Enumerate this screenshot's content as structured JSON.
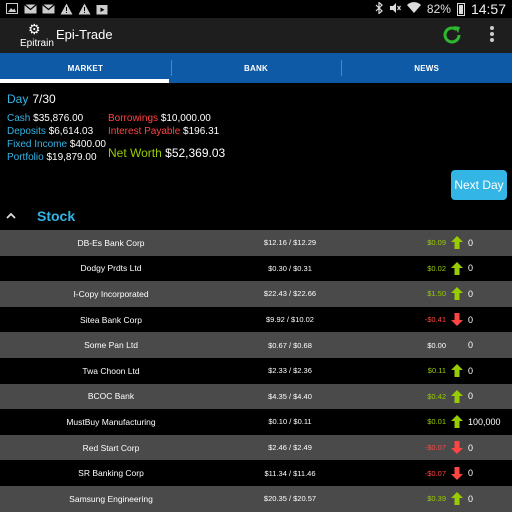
{
  "status_bar": {
    "notification_icons": [
      "image-icon",
      "mail-icon",
      "mail-icon",
      "warning-icon",
      "warning-icon",
      "play-store-icon"
    ],
    "battery": "82%",
    "time": "14:57"
  },
  "action_bar": {
    "logo_text": "Epitrain",
    "title": "Epi-Trade",
    "refresh_color": "#2eb82e"
  },
  "tabs": [
    {
      "label": "MARKET",
      "active": true
    },
    {
      "label": "BANK",
      "active": false
    },
    {
      "label": "NEWS",
      "active": false
    }
  ],
  "summary": {
    "day_label": "Day",
    "day_value": "7/30",
    "cash_label": "Cash",
    "cash_value": "$35,876.00",
    "deposits_label": "Deposits",
    "deposits_value": "$6,614.03",
    "fixed_income_label": "Fixed Income",
    "fixed_income_value": "$400.00",
    "portfolio_label": "Portfolio",
    "portfolio_value": "$19,879.00",
    "borrowings_label": "Borrowings",
    "borrowings_value": "$10,000.00",
    "interest_label": "Interest Payable",
    "interest_value": "$196.31",
    "net_worth_label": "Net Worth",
    "net_worth_value": "$52,369.03",
    "next_day_label": "Next Day"
  },
  "section": {
    "title": "Stock"
  },
  "stocks": [
    {
      "name": "DB-Es Bank Corp",
      "price": "$12.16 / $12.29",
      "change": "$0.09",
      "dir": "up",
      "qty": "0"
    },
    {
      "name": "Dodgy Prdts Ltd",
      "price": "$0.30 / $0.31",
      "change": "$0.02",
      "dir": "up",
      "qty": "0"
    },
    {
      "name": "I-Copy Incorporated",
      "price": "$22.43 / $22.66",
      "change": "$1.50",
      "dir": "up",
      "qty": "0"
    },
    {
      "name": "Sitea Bank Corp",
      "price": "$9.92 / $10.02",
      "change": "-$0.41",
      "dir": "down",
      "qty": "0"
    },
    {
      "name": "Some Pan Ltd",
      "price": "$0.67 / $0.68",
      "change": "$0.00",
      "dir": "flat",
      "qty": "0"
    },
    {
      "name": "Twa Choon Ltd",
      "price": "$2.33 / $2.36",
      "change": "$0.11",
      "dir": "up",
      "qty": "0"
    },
    {
      "name": "BCOC Bank",
      "price": "$4.35 / $4.40",
      "change": "$0.42",
      "dir": "up",
      "qty": "0"
    },
    {
      "name": "MustBuy Manufacturing",
      "price": "$0.10 / $0.11",
      "change": "$0.01",
      "dir": "up",
      "qty": "100,000"
    },
    {
      "name": "Red Start Corp",
      "price": "$2.46 / $2.49",
      "change": "-$0.07",
      "dir": "down",
      "qty": "0"
    },
    {
      "name": "SR Banking Corp",
      "price": "$11.34 / $11.46",
      "change": "-$0.07",
      "dir": "down",
      "qty": "0"
    },
    {
      "name": "Samsung Engineering",
      "price": "$20.35 / $20.57",
      "change": "$0.39",
      "dir": "up",
      "qty": "0"
    }
  ]
}
